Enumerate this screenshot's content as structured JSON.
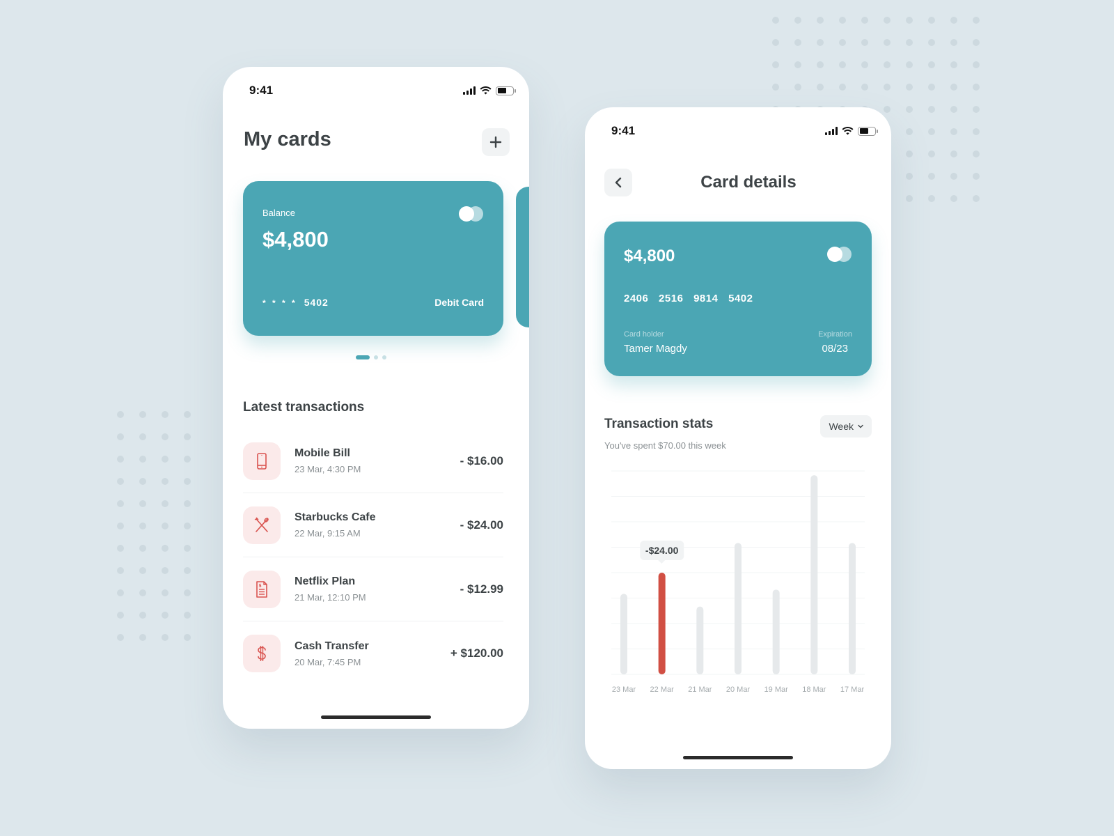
{
  "status_bar": {
    "time": "9:41"
  },
  "my_cards": {
    "title": "My cards",
    "add_icon": "plus-icon",
    "card": {
      "balance_label": "Balance",
      "balance": "$4,800",
      "masked_prefix": "* * * *",
      "last4": "5402",
      "type": "Debit Card",
      "brand_icon": "mastercard-logo-icon"
    },
    "pager": {
      "count": 3,
      "active": 0
    },
    "transactions_title": "Latest transactions",
    "transactions": [
      {
        "name": "Mobile Bill",
        "date": "23 Mar, 4:30 PM",
        "amount": "- $16.00",
        "icon": "smartphone-icon"
      },
      {
        "name": "Starbucks Cafe",
        "date": "22 Mar, 9:15 AM",
        "amount": "- $24.00",
        "icon": "fork-knife-icon"
      },
      {
        "name": "Netflix Plan",
        "date": "21 Mar, 12:10 PM",
        "amount": "- $12.99",
        "icon": "invoice-icon"
      },
      {
        "name": "Cash Transfer",
        "date": "20 Mar, 7:45 PM",
        "amount": "+ $120.00",
        "icon": "dollar-icon"
      }
    ]
  },
  "card_details": {
    "title": "Card details",
    "back_icon": "chevron-left-icon",
    "card": {
      "balance": "$4,800",
      "number": "2406 2516 9814 5402",
      "holder_label": "Card holder",
      "holder": "Tamer Magdy",
      "expiration_label": "Expiration",
      "expiration": "08/23"
    },
    "stats_title": "Transaction stats",
    "stats_subtitle": "You've spent $70.00 this week",
    "period_select": "Week"
  },
  "colors": {
    "accent": "#4ba6b4",
    "highlight_bar": "#d14f43",
    "bar": "#e6e9eb",
    "icon_red": "#d9534f",
    "icon_bg": "#fbeaea",
    "background": "#dde7ec"
  },
  "chart_data": {
    "type": "bar",
    "title": "Transaction stats",
    "categories": [
      "23 Mar",
      "22 Mar",
      "21 Mar",
      "20 Mar",
      "19 Mar",
      "18 Mar",
      "17 Mar"
    ],
    "values": [
      19,
      24,
      16,
      31,
      20,
      47,
      31
    ],
    "highlighted_index": 1,
    "tooltip": "-$24.00",
    "xlabel": "",
    "ylabel": "",
    "ylim": [
      0,
      48
    ],
    "grid": true,
    "legend": "none"
  }
}
